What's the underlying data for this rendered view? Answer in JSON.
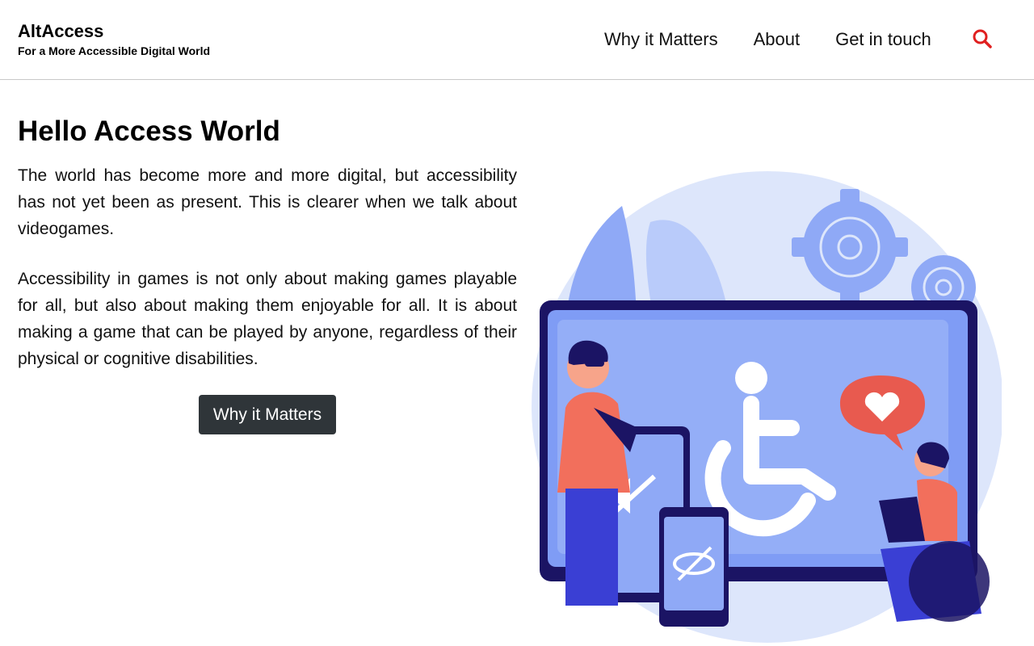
{
  "brand": {
    "name": "AltAccess",
    "tagline": "For a More Accessible Digital World"
  },
  "nav": {
    "items": [
      {
        "label": "Why it Matters"
      },
      {
        "label": "About"
      },
      {
        "label": "Get in touch"
      }
    ],
    "search_icon": "search-icon"
  },
  "hero": {
    "title": "Hello Access World",
    "paragraphs": [
      "The world has become more and more digital, but accessibility has not yet been as present. This is clearer when we talk about videogames.",
      "Accessibility in games is not only about making games playable for all, but also about making them enjoyable for all. It is about making a game that can be played by anyone, regardless of their physical or cognitive disabilities."
    ],
    "cta_label": "Why it Matters"
  },
  "colors": {
    "accent_red": "#e02020",
    "button_bg": "#2f3539",
    "illustration_blue": "#7f9cf5",
    "illustration_dark": "#1b1464",
    "illustration_coral": "#f26f5c"
  }
}
